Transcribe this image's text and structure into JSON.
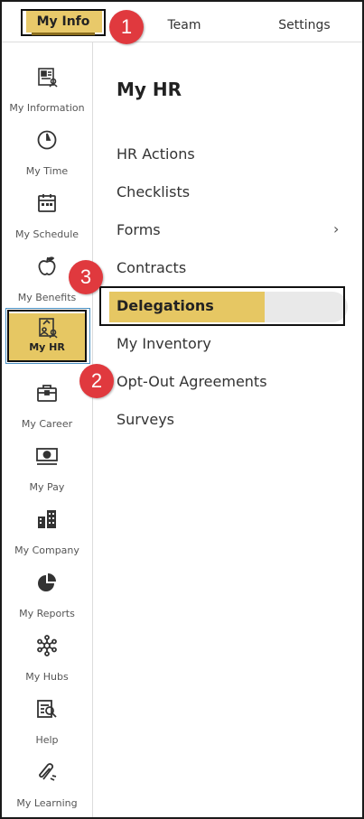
{
  "tabs": [
    {
      "label": "My Info",
      "active": true
    },
    {
      "label": "Team"
    },
    {
      "label": "Settings"
    }
  ],
  "callouts": [
    "1",
    "2",
    "3"
  ],
  "sidebar": {
    "items": [
      {
        "label": "My Information",
        "icon": "id-card-icon"
      },
      {
        "label": "My Time",
        "icon": "clock-icon"
      },
      {
        "label": "My Schedule",
        "icon": "calendar-icon"
      },
      {
        "label": "My Benefits",
        "icon": "apple-icon"
      },
      {
        "label": "My HR",
        "icon": "hr-icon",
        "active": true
      },
      {
        "label": "My Career",
        "icon": "briefcase-icon"
      },
      {
        "label": "My Pay",
        "icon": "pay-icon"
      },
      {
        "label": "My Company",
        "icon": "building-icon"
      },
      {
        "label": "My Reports",
        "icon": "pie-chart-icon"
      },
      {
        "label": "My Hubs",
        "icon": "hub-icon"
      },
      {
        "label": "Help",
        "icon": "help-icon"
      },
      {
        "label": "My Learning",
        "icon": "paperclip-icon"
      }
    ]
  },
  "main": {
    "title": "My HR",
    "menu": [
      {
        "label": "HR Actions"
      },
      {
        "label": "Checklists"
      },
      {
        "label": "Forms",
        "has_submenu": true
      },
      {
        "label": "Contracts"
      },
      {
        "label": "Delegations",
        "selected": true
      },
      {
        "label": "My Inventory"
      },
      {
        "label": "Opt-Out Agreements"
      },
      {
        "label": "Surveys"
      }
    ],
    "chevron": "›"
  },
  "colors": {
    "accent": "#e6c763",
    "callout": "#e0393e",
    "border": "#111111"
  }
}
